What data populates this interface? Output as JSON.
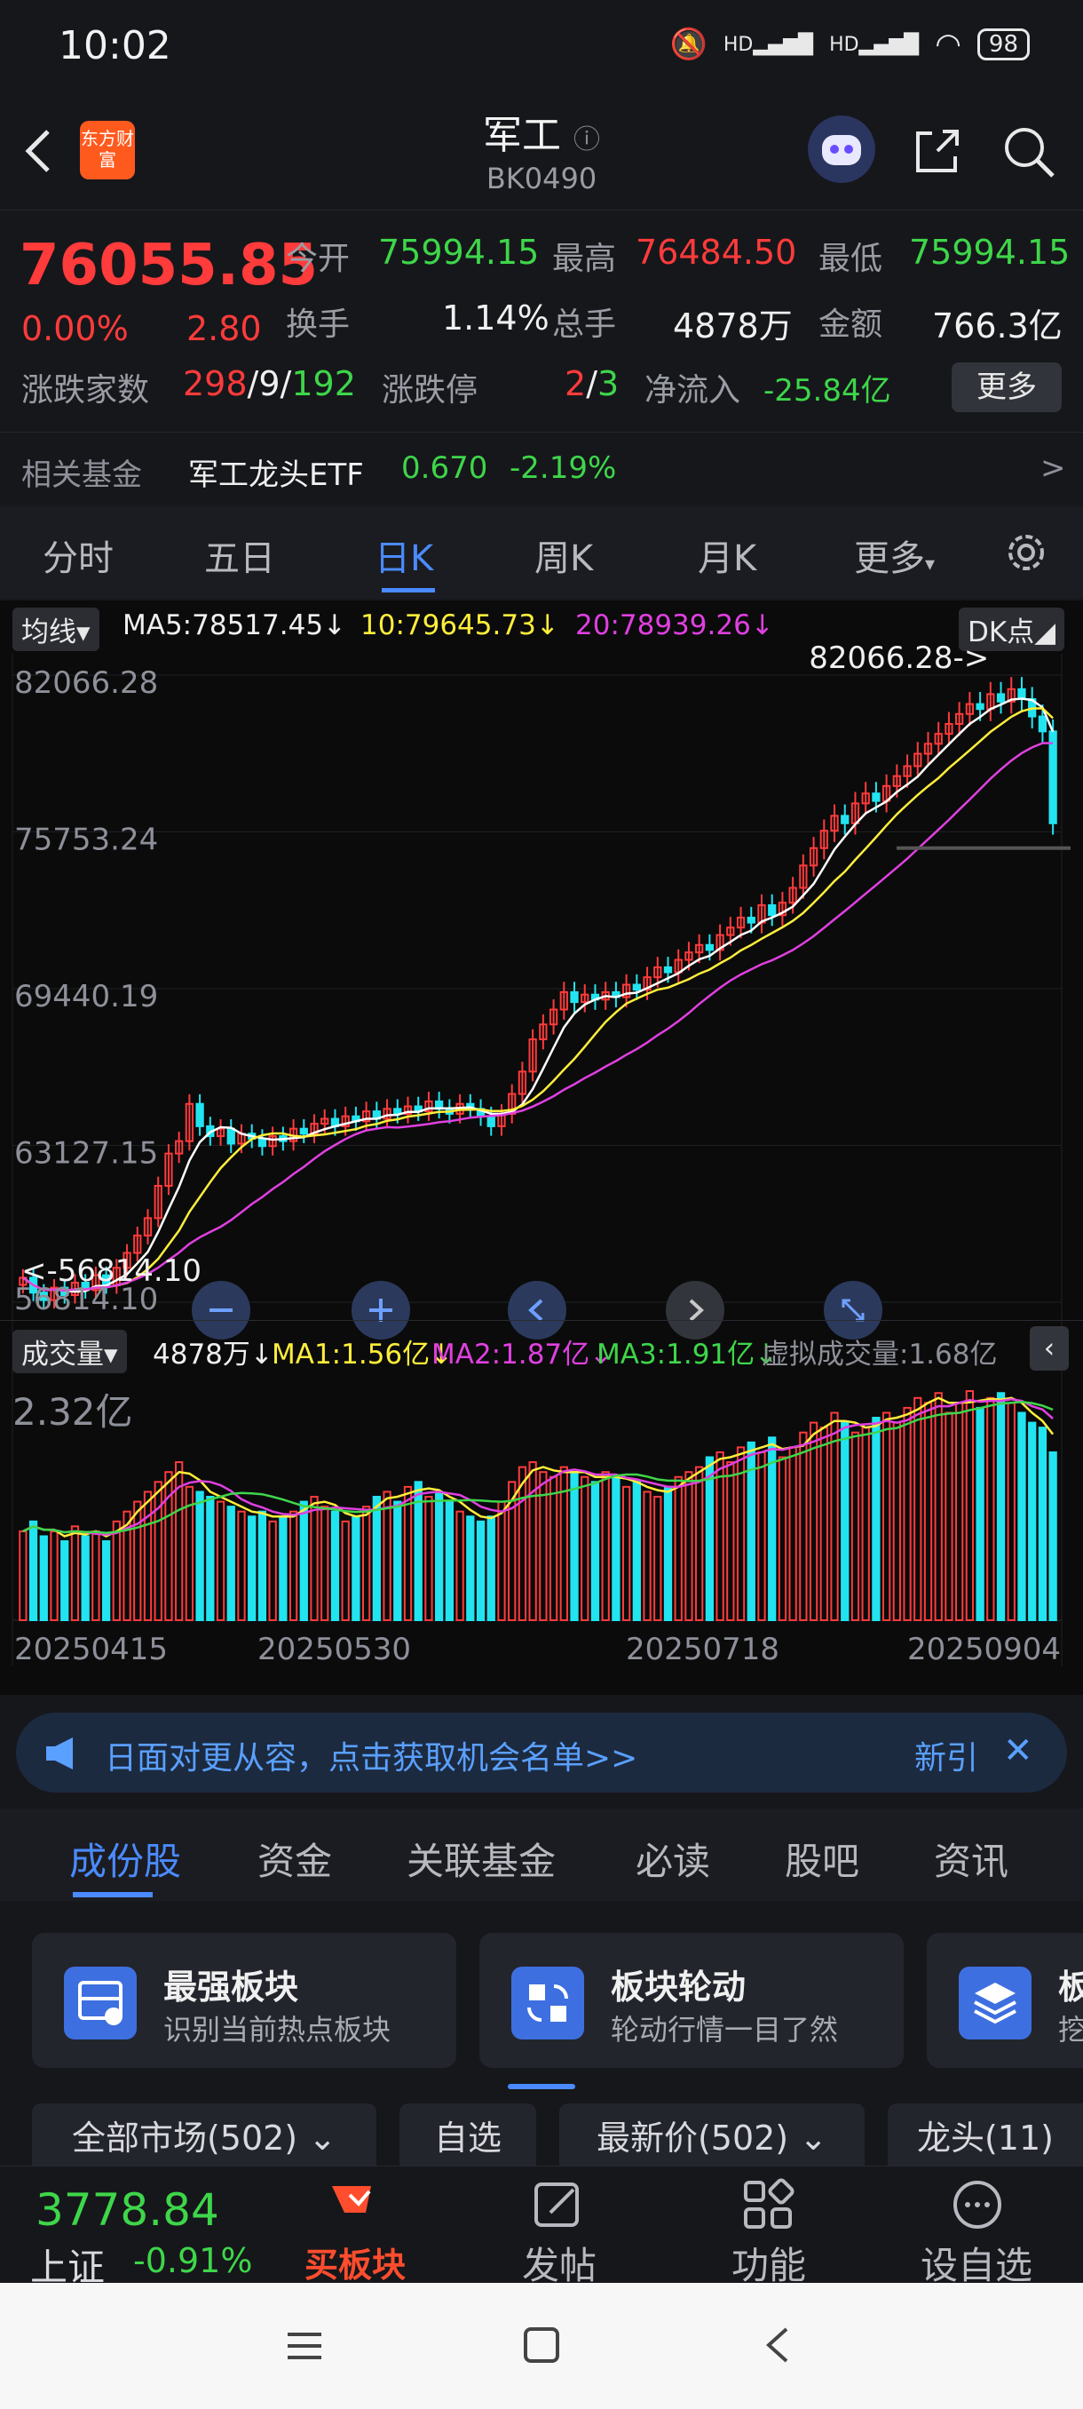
{
  "status_bar": {
    "time": "10:02",
    "network": "HD",
    "battery": "98"
  },
  "header": {
    "title": "军工",
    "code": "BK0490",
    "logo_text": "东方财富"
  },
  "quote": {
    "price": "76055.85",
    "change_pct": "0.00%",
    "change_amt": "2.80",
    "open_label": "今开",
    "open": "75994.15",
    "high_label": "最高",
    "high": "76484.50",
    "low_label": "最低",
    "low": "75994.15",
    "turnover_label": "换手",
    "turnover": "1.14%",
    "volume_label": "总手",
    "volume": "4878万",
    "amount_label": "金额",
    "amount": "766.3亿",
    "breadth_label": "涨跌家数",
    "up_count": "298",
    "flat_count": "9",
    "down_count": "192",
    "limit_label": "涨跌停",
    "limit_up": "2",
    "limit_down": "3",
    "netflow_label": "净流入",
    "netflow": "-25.84亿",
    "more_label": "更多"
  },
  "fund": {
    "label": "相关基金",
    "name": "军工龙头ETF",
    "price": "0.670",
    "change": "-2.19%",
    "arrow": ">"
  },
  "period_tabs": [
    "分时",
    "五日",
    "日K",
    "周K",
    "月K",
    "更多"
  ],
  "active_period": "日K",
  "ma": {
    "selector": "均线",
    "ma5": "MA5:78517.45",
    "ma10": "10:79645.73",
    "ma20": "20:78939.26",
    "dk": "DK点"
  },
  "chart_data": {
    "type": "candlestick",
    "y_ticks": [
      "82066.28",
      "75753.24",
      "69440.19",
      "63127.15",
      "56814.10"
    ],
    "ylim": [
      56814.1,
      82066.28
    ],
    "max_annotation": "82066.28->",
    "min_annotation": "<-56814.10",
    "x_ticks": [
      "20250415",
      "20250530",
      "20250718",
      "20250904"
    ],
    "series_colors": {
      "up": "#ff3b3b",
      "down": "#22e4f0",
      "ma5": "#ffffff",
      "ma10": "#ffee3a",
      "ma20": "#e040e0"
    },
    "close": [
      57800,
      57200,
      56900,
      57400,
      57100,
      57600,
      57300,
      57900,
      57500,
      58200,
      58800,
      59500,
      60200,
      61500,
      62800,
      63300,
      64800,
      63900,
      63500,
      63800,
      63200,
      63600,
      63400,
      63100,
      63500,
      63300,
      63800,
      63600,
      64000,
      64200,
      63900,
      64300,
      64100,
      64500,
      64200,
      64600,
      64400,
      64700,
      64500,
      64900,
      64600,
      64400,
      64800,
      64600,
      64300,
      63900,
      64400,
      65200,
      66100,
      67400,
      68000,
      68600,
      69300,
      68900,
      69200,
      69000,
      69300,
      69100,
      69600,
      69400,
      69900,
      70300,
      70100,
      70600,
      70900,
      71200,
      71000,
      71600,
      71900,
      72300,
      72100,
      72800,
      72400,
      72900,
      73500,
      74400,
      75100,
      75800,
      76400,
      76100,
      76900,
      77300,
      77000,
      77600,
      78000,
      78400,
      78900,
      79300,
      79700,
      80100,
      80500,
      80900,
      80700,
      81300,
      81000,
      81500,
      81100,
      80400,
      79800,
      76100
    ],
    "volume_label": "成交量",
    "volume": "4878万",
    "vol_ma1": "MA1:1.56亿",
    "vol_ma2": "MA2:1.87亿",
    "vol_ma3": "MA3:1.91亿",
    "virtual_volume": "虚拟成交量:1.68亿",
    "vol_ymax": "2.32亿",
    "volumes": [
      0.9,
      1.0,
      0.85,
      0.9,
      0.8,
      0.95,
      0.85,
      0.9,
      0.8,
      1.0,
      1.1,
      1.2,
      1.3,
      1.4,
      1.5,
      1.6,
      1.35,
      1.3,
      1.25,
      1.2,
      1.15,
      1.1,
      1.05,
      1.1,
      1.0,
      1.05,
      1.1,
      1.2,
      1.25,
      1.15,
      1.1,
      1.0,
      1.05,
      1.15,
      1.25,
      1.3,
      1.2,
      1.35,
      1.4,
      1.25,
      1.3,
      1.2,
      1.1,
      1.05,
      1.0,
      1.05,
      1.2,
      1.4,
      1.55,
      1.6,
      1.5,
      1.45,
      1.55,
      1.5,
      1.45,
      1.4,
      1.5,
      1.45,
      1.35,
      1.4,
      1.3,
      1.25,
      1.35,
      1.45,
      1.5,
      1.55,
      1.65,
      1.7,
      1.6,
      1.75,
      1.8,
      1.7,
      1.85,
      1.65,
      1.75,
      1.9,
      2.0,
      1.95,
      2.1,
      2.0,
      1.9,
      1.95,
      2.05,
      2.1,
      2.0,
      2.15,
      2.25,
      2.2,
      2.3,
      2.1,
      2.2,
      2.32,
      2.15,
      2.25,
      2.3,
      2.2,
      2.1,
      2.0,
      1.95,
      1.7
    ]
  },
  "banner": {
    "text": "日面对更从容，点击获取机会名单>>",
    "new": "新引"
  },
  "content_tabs": [
    "成份股",
    "资金",
    "关联基金",
    "必读",
    "股吧",
    "资讯"
  ],
  "cards": [
    {
      "title": "最强板块",
      "subtitle": "识别当前热点板块"
    },
    {
      "title": "板块轮动",
      "subtitle": "轮动行情一目了然"
    },
    {
      "title": "板",
      "subtitle": "挖"
    }
  ],
  "filters": [
    "全部市场(502)",
    "自选",
    "最新价(502)",
    "龙头(11)"
  ],
  "bottom_nav": {
    "index_value": "3778.84",
    "index_name": "上证",
    "index_change": "-0.91%",
    "buy_label": "买板块",
    "post_label": "发帖",
    "func_label": "功能",
    "watch_label": "设自选"
  }
}
